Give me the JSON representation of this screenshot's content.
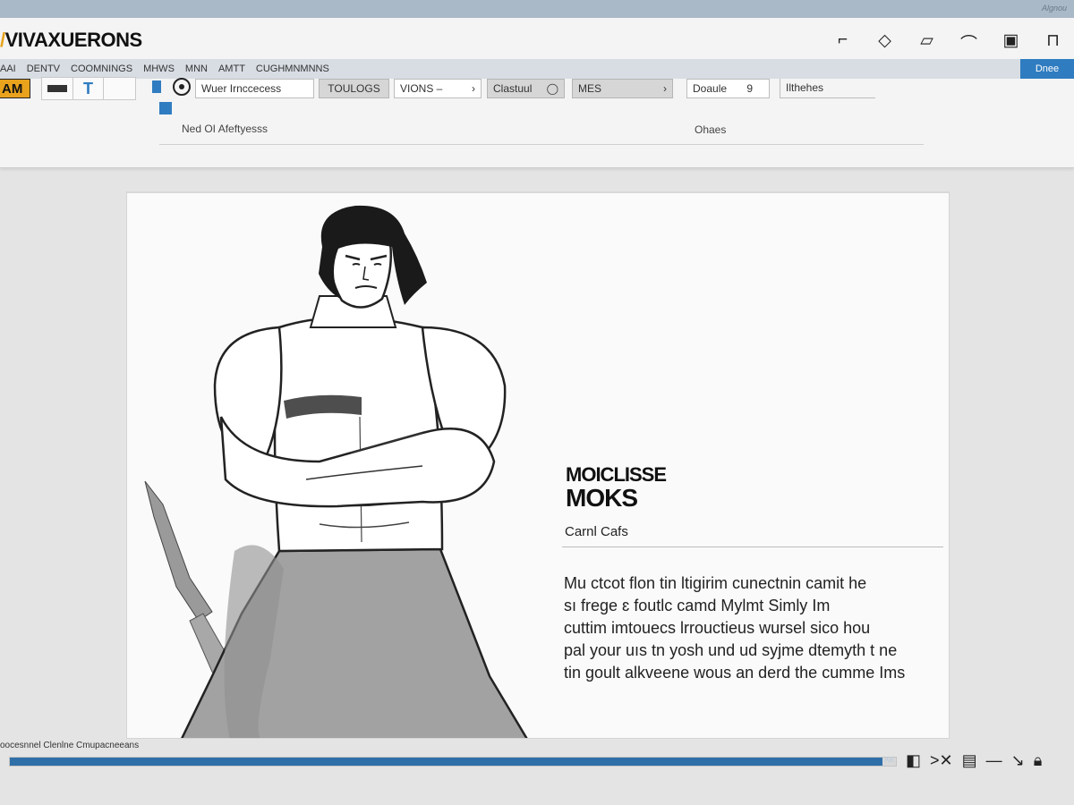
{
  "top_strip": {
    "tiny_label": "Algnou"
  },
  "app": {
    "title": "VIVAXUERONS"
  },
  "window_icons": [
    "crop-icon",
    "shape-icon",
    "tag-icon",
    "curve-icon",
    "frame-icon",
    "pin-icon"
  ],
  "menu": {
    "items": [
      "AAI",
      "DENTV",
      "COOMNINGS",
      "MHWS",
      "MNN",
      "AMTT",
      "CUGHMNMNNS"
    ],
    "done_label": "Dnee"
  },
  "toolbar": {
    "badge": "AM",
    "search_value": "Wuer Irnccecess",
    "sub_label": "Ned OI Afeftyesss",
    "btn_tools": "TOULOGS",
    "btn_views": "VIONS  –",
    "dropdown_custom": "Clastuul",
    "dropdown_mes": "MES",
    "field_douds": "Doaule",
    "field_douds_value": "9",
    "field_douds_sub": "Ohaes",
    "field_lithehes": "Ilthehes"
  },
  "canvas": {
    "promo_title_1": "MOICLISSE",
    "promo_title_2": "MOKS",
    "promo_subtitle": "Carnl Cafs",
    "promo_body": [
      "Mu ctcot flon tin ltigirim cunectnin camit he",
      "sı frege ɛ foutlc camd Mylmt Simly Im",
      "cuttim imtouecs lrrouctieus wursel sico hou",
      "pal your uıs tn yosh und ud syjme dtemyth t ne",
      "tin goult alkveene wous an derd the cumme Ims"
    ]
  },
  "status": {
    "left_text": "oocesnnel Clenlne Cmupacneeans",
    "progress": 0.985,
    "end_glyph": "AB",
    "icons": [
      "panel-icon",
      "shuffle-icon",
      "list-icon",
      "line-icon",
      "check-icon",
      "lock-icon"
    ]
  },
  "colors": {
    "accent_orange": "#e8a21c",
    "accent_blue": "#2f7cc0",
    "progress_blue": "#2f6fa8"
  }
}
